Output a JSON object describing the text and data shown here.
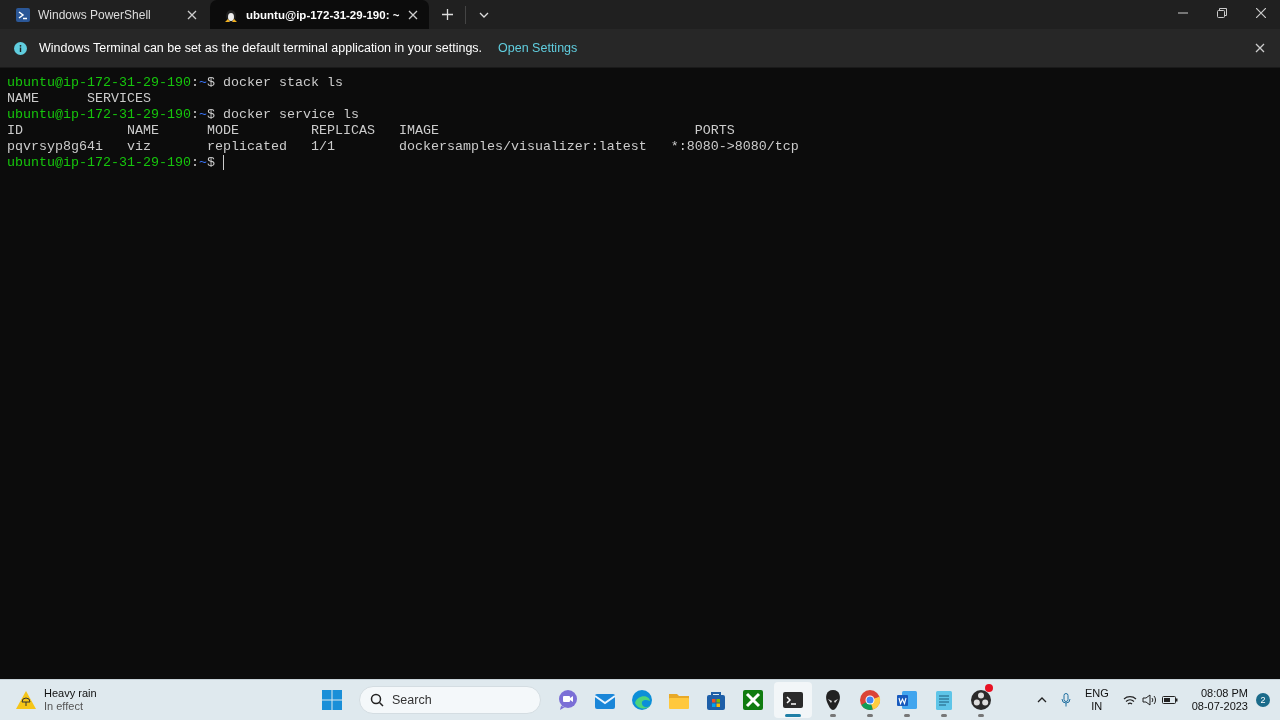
{
  "tabs": [
    {
      "kind": "powershell",
      "label": "Windows PowerShell",
      "selected": false
    },
    {
      "kind": "linux",
      "label": "ubuntu@ip-172-31-29-190: ~",
      "selected": true
    }
  ],
  "infobar": {
    "message": "Windows Terminal can be set as the default terminal application in your settings.",
    "link": "Open Settings"
  },
  "terminal": {
    "lines": [
      {
        "kind": "prompt",
        "user_host": "ubuntu@ip-172-31-29-190",
        "separator": ":",
        "path": "~",
        "symbol": "$",
        "command": "docker stack ls",
        "cursor": false
      },
      {
        "kind": "output",
        "text": "NAME      SERVICES"
      },
      {
        "kind": "prompt",
        "user_host": "ubuntu@ip-172-31-29-190",
        "separator": ":",
        "path": "~",
        "symbol": "$",
        "command": "docker service ls",
        "cursor": false
      },
      {
        "kind": "output",
        "text": "ID             NAME      MODE         REPLICAS   IMAGE                                PORTS"
      },
      {
        "kind": "output",
        "text": "pqvrsyp8g64i   viz       replicated   1/1        dockersamples/visualizer:latest   *:8080->8080/tcp"
      },
      {
        "kind": "prompt",
        "user_host": "ubuntu@ip-172-31-29-190",
        "separator": ":",
        "path": "~",
        "symbol": "$",
        "cursor": true
      }
    ]
  },
  "taskbar": {
    "weather": {
      "title": "Heavy rain",
      "subtitle": "In effect"
    },
    "search": {
      "placeholder": "Search"
    },
    "apps": [
      {
        "kind": "chat",
        "running": false,
        "selected": false,
        "badge": false
      },
      {
        "kind": "mail",
        "running": false,
        "selected": false,
        "badge": false
      },
      {
        "kind": "edge",
        "running": false,
        "selected": false,
        "badge": false
      },
      {
        "kind": "folder",
        "running": false,
        "selected": false,
        "badge": false
      },
      {
        "kind": "store",
        "running": false,
        "selected": false,
        "badge": false
      },
      {
        "kind": "xbox",
        "running": false,
        "selected": false,
        "badge": false
      },
      {
        "kind": "terminal",
        "running": true,
        "selected": true,
        "badge": false
      },
      {
        "kind": "alien",
        "running": true,
        "selected": false,
        "badge": false
      },
      {
        "kind": "chrome",
        "running": true,
        "selected": false,
        "badge": false
      },
      {
        "kind": "word",
        "running": true,
        "selected": false,
        "badge": false
      },
      {
        "kind": "notepad",
        "running": true,
        "selected": false,
        "badge": false
      },
      {
        "kind": "obs",
        "running": true,
        "selected": false,
        "badge": true
      }
    ],
    "language": {
      "top": "ENG",
      "bottom": "IN"
    },
    "time": "08:08 PM",
    "date": "08-07-2023",
    "notifications": "2"
  }
}
